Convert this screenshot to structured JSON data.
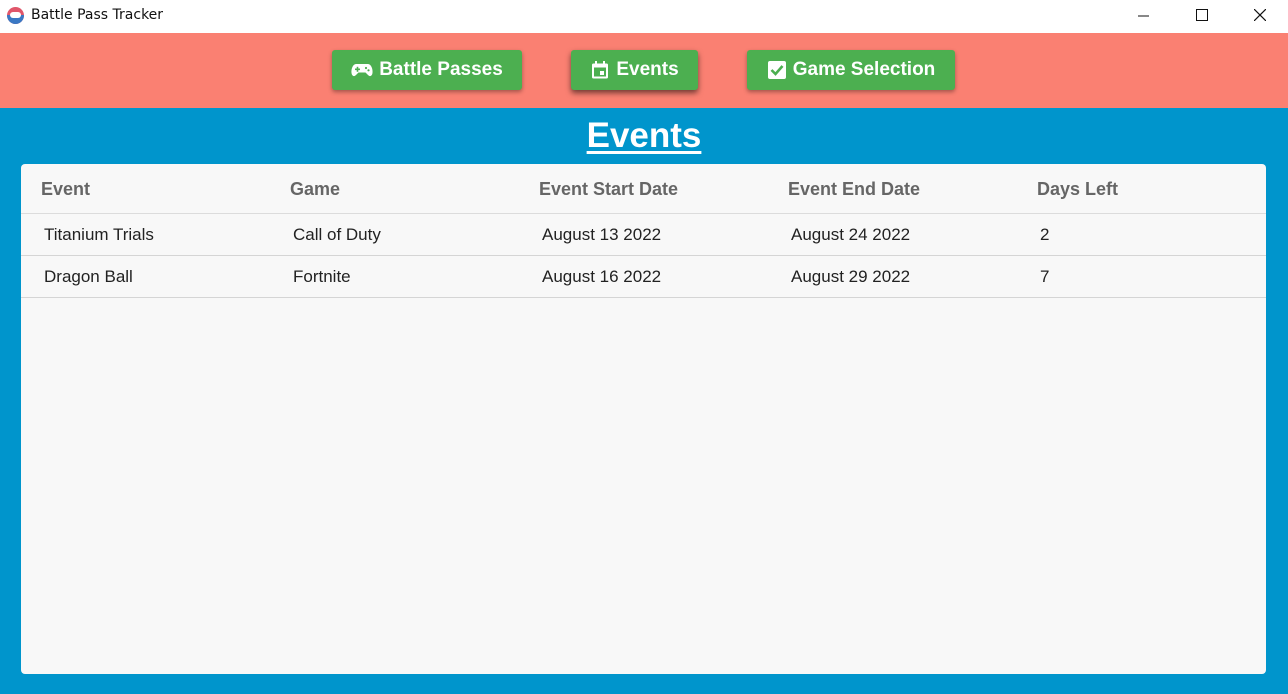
{
  "window": {
    "title": "Battle Pass Tracker"
  },
  "nav": {
    "buttons": [
      {
        "label": "Battle Passes",
        "icon": "gamepad-icon"
      },
      {
        "label": "Events",
        "icon": "calendar-icon"
      },
      {
        "label": "Game Selection",
        "icon": "checkbox-icon"
      }
    ],
    "active": "Events"
  },
  "page": {
    "title": "Events"
  },
  "table": {
    "columns": [
      "Event",
      "Game",
      "Event Start Date",
      "Event End Date",
      "Days Left"
    ],
    "rows": [
      [
        "Titanium Trials",
        "Call of Duty",
        "August 13 2022",
        "August 24 2022",
        "2"
      ],
      [
        "Dragon Ball",
        "Fortnite",
        "August 16 2022",
        "August 29 2022",
        "7"
      ]
    ]
  },
  "colors": {
    "toolbar": "#fa8072",
    "background": "#0095cc",
    "button": "#4caf50",
    "card": "#f8f8f8"
  }
}
